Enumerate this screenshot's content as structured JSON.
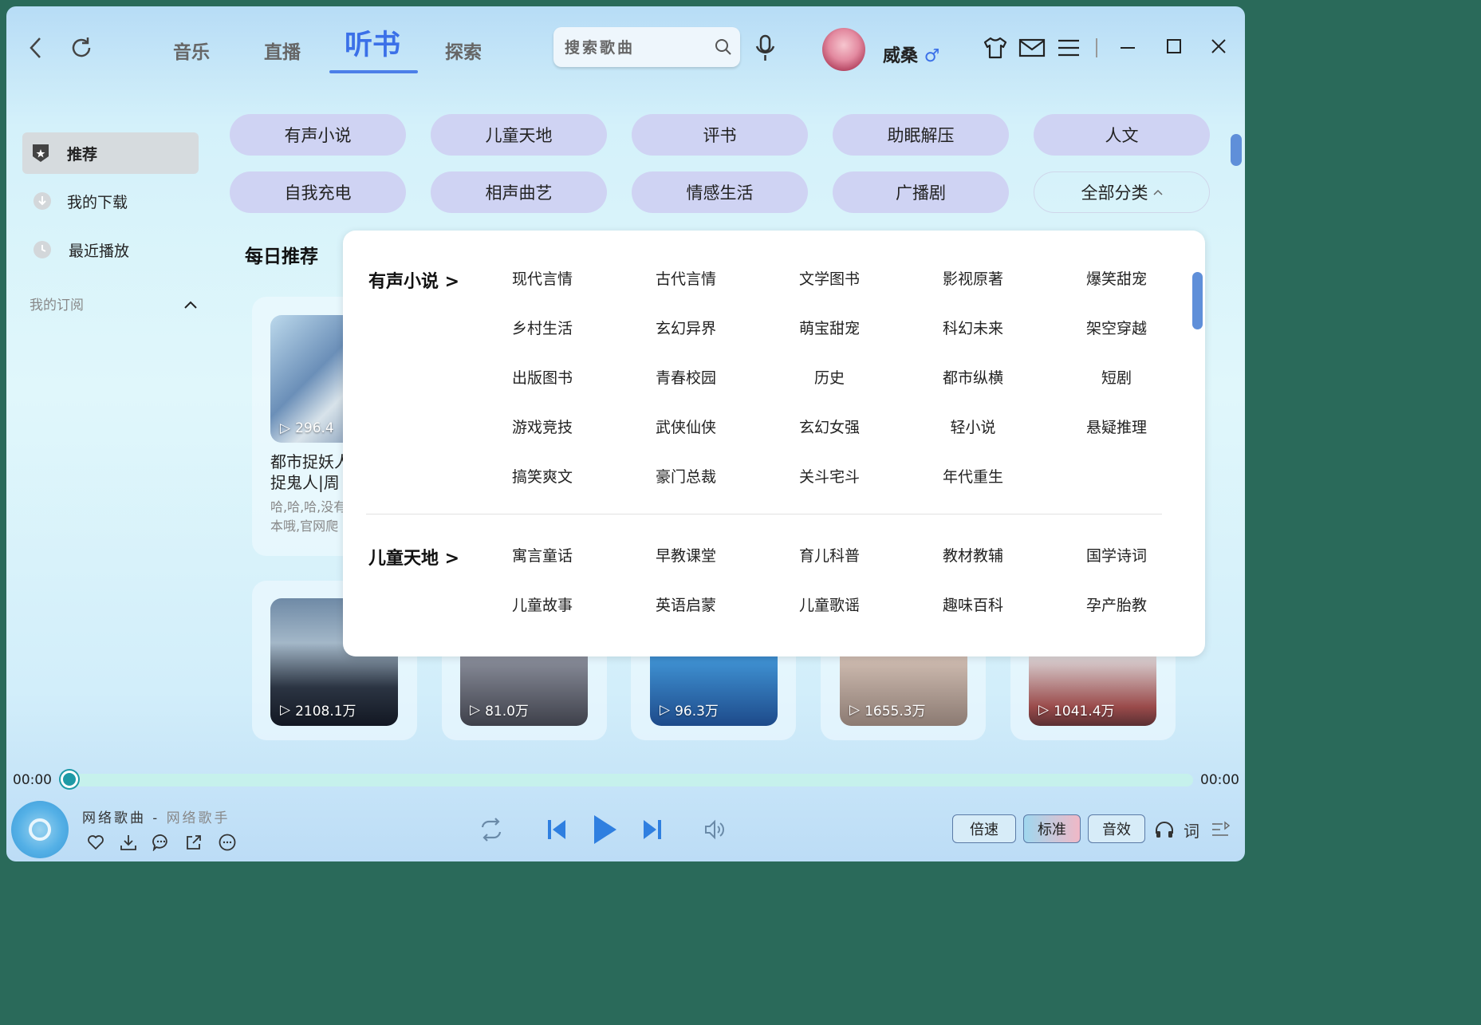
{
  "topbar": {
    "tabs": [
      {
        "label": "音乐",
        "active": false
      },
      {
        "label": "直播",
        "active": false
      },
      {
        "label": "听书",
        "active": true
      },
      {
        "label": "探索",
        "active": false
      }
    ],
    "search_placeholder": "搜索歌曲",
    "username": "威桑",
    "gender_symbol": "♂"
  },
  "sidebar": {
    "items": [
      {
        "label": "推荐",
        "icon": "badge-star-icon",
        "active": true
      },
      {
        "label": "我的下载",
        "icon": "download-circle-icon",
        "active": false
      },
      {
        "label": "最近播放",
        "icon": "clock-icon",
        "active": false
      }
    ],
    "subscriptions_label": "我的订阅"
  },
  "categories": {
    "row1": [
      "有声小说",
      "儿童天地",
      "评书",
      "助眠解压",
      "人文"
    ],
    "row2": [
      "自我充电",
      "相声曲艺",
      "情感生活",
      "广播剧"
    ],
    "all_label": "全部分类"
  },
  "daily": {
    "title": "每日推荐",
    "cards_row1": [
      {
        "count": "296.4",
        "title_line1": "都市捉妖人",
        "title_line2": "捉鬼人|周",
        "desc_line1": "哈,哈,哈,没有",
        "desc_line2": "本哦,官网爬"
      }
    ],
    "cards_row2": [
      {
        "count": "2108.1万"
      },
      {
        "count": "81.0万"
      },
      {
        "count": "96.3万"
      },
      {
        "count": "1655.3万"
      },
      {
        "count": "1041.4万"
      }
    ]
  },
  "popup": {
    "sections": [
      {
        "title": "有声小说 >",
        "items": [
          "现代言情",
          "古代言情",
          "文学图书",
          "影视原著",
          "爆笑甜宠",
          "乡村生活",
          "玄幻异界",
          "萌宝甜宠",
          "科幻未来",
          "架空穿越",
          "出版图书",
          "青春校园",
          "历史",
          "都市纵横",
          "短剧",
          "游戏竞技",
          "武侠仙侠",
          "玄幻女强",
          "轻小说",
          "悬疑推理",
          "搞笑爽文",
          "豪门总裁",
          "关斗宅斗",
          "年代重生"
        ]
      },
      {
        "title": "儿童天地 >",
        "items": [
          "寓言童话",
          "早教课堂",
          "育儿科普",
          "教材教辅",
          "国学诗词",
          "儿童故事",
          "英语启蒙",
          "儿童歌谣",
          "趣味百科",
          "孕产胎教"
        ]
      }
    ]
  },
  "player": {
    "time_current": "00:00",
    "time_total": "00:00",
    "song_title": "网络歌曲",
    "separator": " - ",
    "artist": "网络歌手",
    "progress": 0,
    "speed_label": "倍速",
    "quality_label": "标准",
    "effects_label": "音效",
    "lyrics_label": "词"
  }
}
